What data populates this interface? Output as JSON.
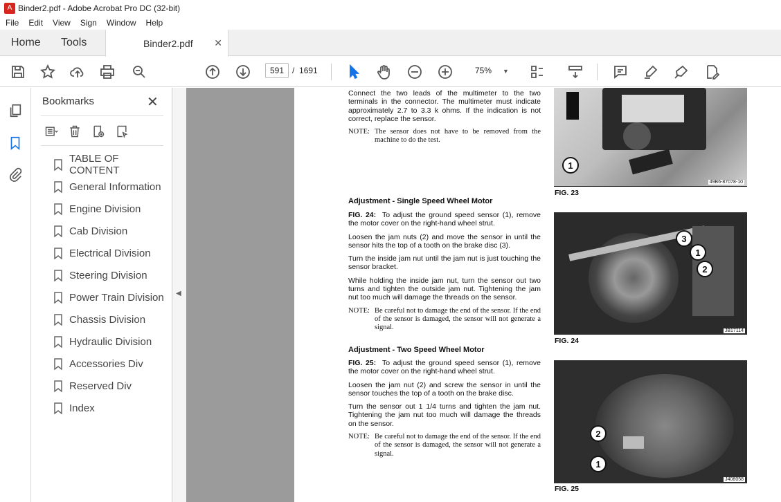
{
  "window": {
    "title": "Binder2.pdf - Adobe Acrobat Pro DC (32-bit)"
  },
  "menu": [
    "File",
    "Edit",
    "View",
    "Sign",
    "Window",
    "Help"
  ],
  "tabs": {
    "home": "Home",
    "tools": "Tools",
    "document": "Binder2.pdf"
  },
  "toolbar": {
    "page_current": "591",
    "page_separator": "/",
    "page_total": "1691",
    "zoom": "75%"
  },
  "bookmarks": {
    "title": "Bookmarks",
    "items": [
      "TABLE OF CONTENT",
      "General Information",
      "Engine Division",
      "Cab Division",
      "Electrical Division",
      "Steering Division",
      "Power Train Division",
      "Chassis Division",
      "Hydraulic Division",
      "Accessories Div",
      "Reserved Div",
      "Index"
    ]
  },
  "doc": {
    "intro": "Connect the two leads of the multimeter to the two terminals in the connector. The multimeter must indicate approximately 2.7 to 3.3 k ohms. If the indication is not correct, replace the sensor.",
    "note1_label": "NOTE:",
    "note1_text": "The sensor does not have to be removed from the machine to do the test.",
    "fig23_caption": "FIG. 23",
    "fig23_code": "49B6-87078-10",
    "heading1": "Adjustment - Single Speed Wheel Motor",
    "p1_label": "FIG. 24:",
    "p1": "To adjust the ground speed sensor (1), remove the motor cover on the right-hand wheel strut.",
    "p2": "Loosen the jam nuts (2) and move the sensor in until the sensor hits the top of a tooth on the brake disc (3).",
    "p3": "Turn the inside jam nut until the jam nut is just touching the sensor bracket.",
    "p4": "While holding the inside jam nut, turn the sensor out two turns and tighten the outside jam nut. Tightening the jam nut too much will damage the threads on the sensor.",
    "note2_label": "NOTE:",
    "note2_text": "Be careful not to damage the end of the sensor. If the end of the sensor is damaged, the sensor will not generate a signal.",
    "fig24_caption": "FIG. 24",
    "fig24_code": "JB17114",
    "heading2": "Adjustment - Two Speed Wheel Motor",
    "q1_label": "FIG. 25:",
    "q1": "To adjust the ground speed sensor (1), remove the motor cover on the right-hand wheel strut.",
    "q2": "Loosen the jam nut (2) and screw the sensor in until the sensor touches the top of a tooth on the brake disc.",
    "q3": "Turn the sensor out 1 1/4 turns and tighten the jam nut. Tightening the jam nut too much will damage the threads on the sensor.",
    "note3_label": "NOTE:",
    "note3_text": "Be careful not to damage the end of the sensor. If the end of the sensor is damaged, the sensor will not generate a signal.",
    "fig25_caption": "FIG. 25",
    "fig25_code": "J408058",
    "callouts": {
      "one": "1",
      "two": "2",
      "three": "3"
    }
  }
}
